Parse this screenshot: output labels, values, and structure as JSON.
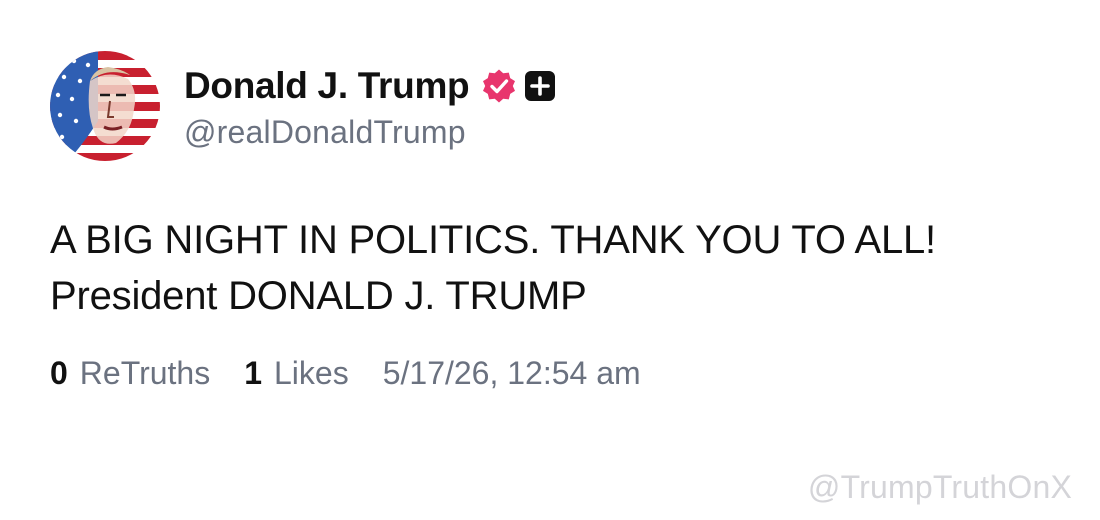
{
  "post": {
    "author": {
      "display_name": "Donald J. Trump",
      "handle": "@realDonaldTrump",
      "avatar_icon": "flag-portrait-avatar",
      "verified_icon": "verified-badge-icon",
      "verified_color": "#e8356d",
      "plus_icon": "plus-square-icon"
    },
    "body": {
      "line1": "A BIG NIGHT IN POLITICS. THANK YOU TO ALL!",
      "line2": "President DONALD J. TRUMP"
    },
    "stats": {
      "retruths_count": "0",
      "retruths_label": "ReTruths",
      "likes_count": "1",
      "likes_label": "Likes",
      "timestamp": "5/17/26, 12:54 am"
    }
  },
  "watermark": "@TrumpTruthOnX",
  "colors": {
    "text_primary": "#111111",
    "text_secondary": "#6b7280",
    "watermark": "#d4d4d8",
    "badge_pink": "#e8356d"
  }
}
